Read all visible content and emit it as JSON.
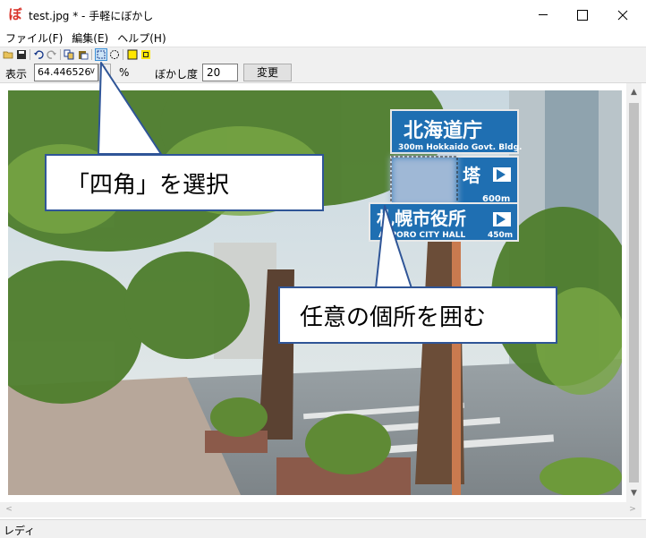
{
  "window": {
    "title": "test.jpg * - 手軽にぼかし",
    "app_icon_glyph": "ぼ"
  },
  "menu": {
    "items": [
      {
        "label": "ファイル(F)"
      },
      {
        "label": "編集(E)"
      },
      {
        "label": "ヘルプ(H)"
      }
    ]
  },
  "toolbar": {
    "buttons": [
      "open-icon",
      "save-icon",
      "undo-icon",
      "redo-icon",
      "copy-icon",
      "paste-icon",
      "rect-select-icon",
      "ellipse-select-icon",
      "rect-color-icon",
      "rect-color-small-icon"
    ],
    "active": "rect-select-icon",
    "accent": "#3b8fd6",
    "highlight_color": "#ffe600"
  },
  "options": {
    "zoom_label": "表示",
    "zoom_value": "64.446526",
    "percent_label": "%",
    "blur_label": "ぼかし度",
    "blur_value": "20",
    "apply_label": "変更"
  },
  "photo": {
    "sign_top_kanji": "北海道庁",
    "sign_top_romaji": "300m Hokkaido Govt. Bldg.",
    "sign_mid_kanji": "塔",
    "sign_mid_distance": "600m",
    "sign_bottom_kanji": "札幌市役所",
    "sign_bottom_romaji": "APPORO CITY HALL",
    "sign_bottom_distance": "450m",
    "sign_color": "#1f6fb2"
  },
  "callouts": {
    "first": "「四角」を選択",
    "second": "任意の個所を囲む",
    "border_color": "#2f5597"
  },
  "status": {
    "text": "レディ"
  }
}
